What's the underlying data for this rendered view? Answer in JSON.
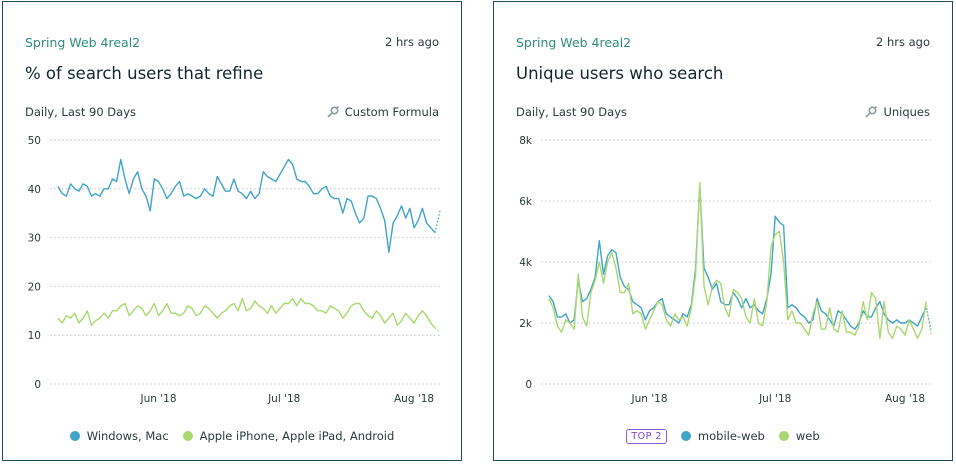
{
  "cards": [
    {
      "board": "Spring Web 4real2",
      "time": "2 hrs ago",
      "title": "% of search users that refine",
      "range": "Daily, Last 90 Days",
      "metric": "Custom Formula",
      "legend": [
        {
          "label": "Windows, Mac",
          "color": "#3fa4c8"
        },
        {
          "label": "Apple iPhone, Apple iPad, Android",
          "color": "#a9d86e"
        }
      ]
    },
    {
      "board": "Spring Web 4real2",
      "time": "2 hrs ago",
      "title": "Unique users who search",
      "range": "Daily, Last 90 Days",
      "metric": "Uniques",
      "badge": "TOP 2",
      "legend": [
        {
          "label": "mobile-web",
          "color": "#3fa4c8"
        },
        {
          "label": "web",
          "color": "#a9d86e"
        }
      ]
    }
  ],
  "chart_data": [
    {
      "type": "line",
      "ylim": [
        0,
        50
      ],
      "yticks": [
        0,
        10,
        20,
        30,
        40,
        50
      ],
      "x_range": [
        "2018-05-08",
        "2018-08-05"
      ],
      "xticks": [
        {
          "label": "Jun '18",
          "day": 24
        },
        {
          "label": "Jul '18",
          "day": 54
        },
        {
          "label": "Aug '18",
          "day": 85
        }
      ],
      "series": [
        {
          "name": "Windows, Mac",
          "color": "#3fa4c8",
          "values": [
            40.5,
            39,
            38.5,
            41,
            40,
            39.5,
            41,
            40.5,
            38.5,
            39,
            38.5,
            40,
            40,
            42,
            41.5,
            46,
            42,
            39,
            42,
            43.5,
            40,
            38.5,
            35.5,
            42,
            41.5,
            40,
            38,
            39,
            40.5,
            41.5,
            38.5,
            39,
            38.5,
            38,
            38.5,
            40,
            39,
            38.5,
            42.5,
            41,
            39.5,
            39.5,
            42,
            39.5,
            39,
            38,
            39.5,
            38,
            39,
            43.5,
            42.5,
            42,
            41.5,
            43,
            44.5,
            46,
            45,
            42,
            41.5,
            41.5,
            40.5,
            39,
            39,
            40,
            40.5,
            38.5,
            38,
            38,
            35,
            38,
            37.5,
            35,
            33,
            34,
            38.5,
            38.5,
            38,
            36,
            33.5,
            27,
            33,
            34.5,
            36.5,
            34,
            36,
            32,
            33.5,
            36,
            33,
            32,
            31
          ],
          "projection": [
            31,
            35.5
          ]
        },
        {
          "name": "Apple iPhone, Apple iPad, Android",
          "color": "#a9d86e",
          "values": [
            13.5,
            12.5,
            14,
            13.5,
            14.5,
            12.5,
            13.5,
            15,
            12,
            13,
            13.5,
            14.5,
            13.5,
            15,
            15,
            16,
            16.5,
            14,
            15,
            16,
            15.5,
            14,
            15,
            16.5,
            14,
            15,
            16.5,
            14.5,
            14.5,
            14,
            14.5,
            16,
            15.5,
            14,
            14.5,
            16,
            15.5,
            14.5,
            13.5,
            14.5,
            15,
            16,
            16.5,
            15,
            17.5,
            15,
            15.5,
            17,
            16,
            15.5,
            14.5,
            16,
            14.5,
            15.5,
            16.5,
            16.5,
            17.5,
            16,
            17.5,
            16.5,
            16.5,
            16,
            15,
            15,
            14.5,
            16,
            15.5,
            15,
            13.5,
            14.5,
            16,
            16.5,
            16.5,
            15,
            14,
            13.5,
            15,
            14,
            12.5,
            13.5,
            14.5,
            12,
            13,
            14.5,
            13.5,
            12.5,
            14,
            15,
            14,
            12.5,
            11.5
          ],
          "projection": [
            11.5,
            10.5
          ]
        }
      ]
    },
    {
      "type": "line",
      "ylim": [
        0,
        8000
      ],
      "yticks": [
        {
          "v": 0,
          "label": "0"
        },
        {
          "v": 2000,
          "label": "2k"
        },
        {
          "v": 4000,
          "label": "4k"
        },
        {
          "v": 6000,
          "label": "6k"
        },
        {
          "v": 8000,
          "label": "8k"
        }
      ],
      "x_range": [
        "2018-05-08",
        "2018-08-05"
      ],
      "xticks": [
        {
          "label": "Jun '18",
          "day": 24
        },
        {
          "label": "Jul '18",
          "day": 54
        },
        {
          "label": "Aug '18",
          "day": 85
        }
      ],
      "series": [
        {
          "name": "mobile-web",
          "color": "#3fa4c8",
          "values": [
            2900,
            2700,
            2200,
            2200,
            2300,
            2000,
            2100,
            3400,
            2700,
            2800,
            3100,
            3500,
            4700,
            3600,
            4200,
            4400,
            4300,
            3500,
            3200,
            3100,
            2700,
            2600,
            2500,
            2100,
            2400,
            2500,
            2700,
            2800,
            2300,
            2200,
            2100,
            2000,
            2300,
            2200,
            2600,
            3800,
            6500,
            3800,
            3500,
            3100,
            3300,
            2700,
            2600,
            2600,
            3000,
            2800,
            2500,
            2800,
            2500,
            2600,
            2400,
            2300,
            2800,
            3600,
            5500,
            5300,
            5200,
            2500,
            2600,
            2500,
            2300,
            2200,
            2000,
            2100,
            2800,
            2400,
            2300,
            2100,
            1900,
            2400,
            2300,
            2100,
            1900,
            1800,
            2000,
            2400,
            2200,
            2200,
            2500,
            2700,
            2300,
            2100,
            2000,
            2100,
            2000,
            2000,
            2100,
            2000,
            1900,
            2200,
            2500
          ],
          "projection": [
            2500,
            1800
          ]
        },
        {
          "name": "web",
          "color": "#a9d86e",
          "values": [
            2800,
            2500,
            1900,
            1700,
            2100,
            2000,
            1800,
            3600,
            2200,
            1900,
            3000,
            3400,
            4000,
            3300,
            4000,
            4300,
            3800,
            3000,
            3000,
            3300,
            2300,
            2400,
            2300,
            1800,
            2100,
            2400,
            2700,
            2600,
            2100,
            1900,
            2300,
            2100,
            2200,
            1900,
            2500,
            3600,
            6600,
            3200,
            2600,
            3200,
            3400,
            3300,
            2500,
            2200,
            3100,
            3000,
            2800,
            2200,
            2000,
            2800,
            2000,
            1900,
            2700,
            4500,
            4900,
            5000,
            4000,
            2100,
            2400,
            2000,
            2000,
            1800,
            1600,
            2300,
            2700,
            1800,
            1800,
            2500,
            1800,
            1700,
            2400,
            1700,
            1700,
            1600,
            1900,
            2700,
            2100,
            3000,
            2800,
            1500,
            2700,
            1700,
            1500,
            1900,
            1800,
            1600,
            2100,
            1800,
            1500,
            1800,
            2700
          ],
          "projection": [
            2700,
            1600
          ]
        }
      ]
    }
  ]
}
